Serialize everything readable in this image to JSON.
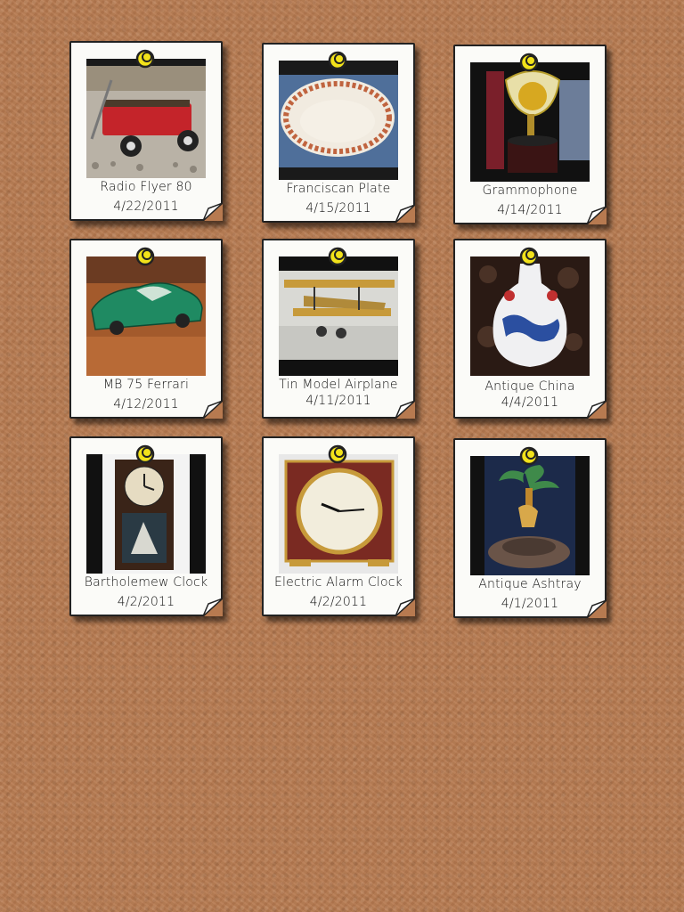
{
  "items": [
    {
      "name": "Radio Flyer 80",
      "date": "4/22/2011",
      "thumb": "wagon-photo"
    },
    {
      "name": "Franciscan Plate",
      "date": "4/15/2011",
      "thumb": "plate-photo"
    },
    {
      "name": "Grammophone",
      "date": "4/14/2011",
      "thumb": "gramophone-photo"
    },
    {
      "name": "MB 75 Ferrari",
      "date": "4/12/2011",
      "thumb": "toy-car-photo"
    },
    {
      "name": "Tin Model Airplane",
      "date": "4/11/2011",
      "thumb": "biplane-photo"
    },
    {
      "name": "Antique China",
      "date": "4/4/2011",
      "thumb": "vase-photo"
    },
    {
      "name": "Bartholemew Clock",
      "date": "4/2/2011",
      "thumb": "wall-clock-photo"
    },
    {
      "name": "Electric Alarm Clock",
      "date": "4/2/2011",
      "thumb": "alarm-clock-photo"
    },
    {
      "name": "Antique Ashtray",
      "date": "4/1/2011",
      "thumb": "ashtray-photo"
    }
  ],
  "colors": {
    "board": "#b77a50",
    "card": "#fbfbf8",
    "pin": "#f2e21a"
  }
}
